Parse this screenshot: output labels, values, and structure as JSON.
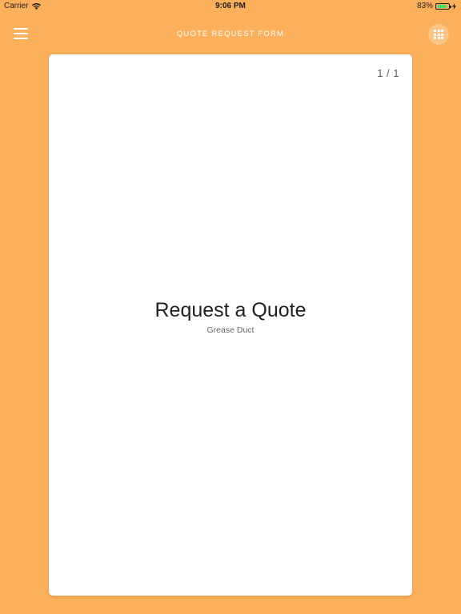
{
  "status_bar": {
    "carrier": "Carrier",
    "time": "9:06 PM",
    "battery_percent": "83%",
    "battery_level": 0.83,
    "wifi_icon": "wifi-icon",
    "charging_icon": "lightning-icon"
  },
  "nav": {
    "title": "QUOTE REQUEST FORM",
    "menu_icon": "hamburger-menu-icon",
    "grid_icon": "grid-icon"
  },
  "card": {
    "page_counter": "1 / 1",
    "title": "Request a Quote",
    "subtitle": "Grease Duct"
  },
  "colors": {
    "background": "#FDB05C",
    "card": "#FFFFFF",
    "battery": "#4CD964"
  }
}
